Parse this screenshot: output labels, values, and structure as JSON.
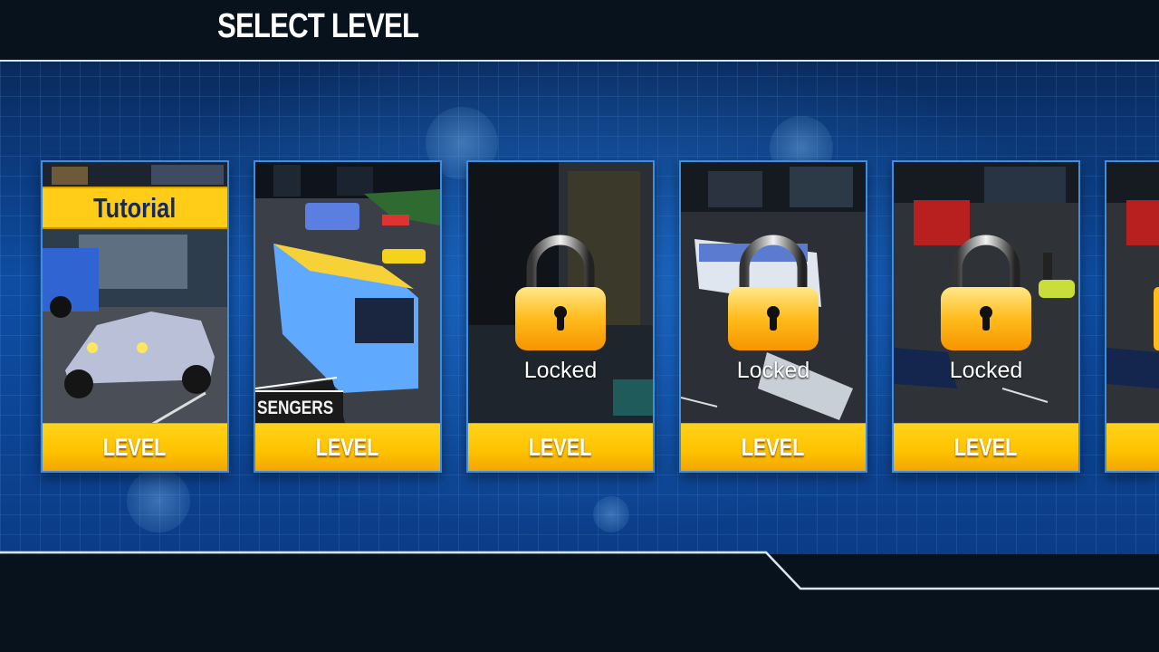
{
  "header": {
    "title": "SELECT LEVEL"
  },
  "levels": [
    {
      "state": "unlocked",
      "ribbon": "Tutorial",
      "button": "LEVEL"
    },
    {
      "state": "unlocked",
      "overlay_text": "SENGERS",
      "button": "LEVEL"
    },
    {
      "state": "locked",
      "locked_text": "Locked",
      "button": "LEVEL"
    },
    {
      "state": "locked",
      "locked_text": "Locked",
      "button": "LEVEL"
    },
    {
      "state": "locked",
      "locked_text": "Locked",
      "button": "LEVEL"
    },
    {
      "state": "locked",
      "button": ""
    }
  ],
  "icons": {
    "lock": "padlock-icon"
  },
  "colors": {
    "accent_yellow": "#ffc400",
    "card_border": "#3d8de0",
    "background_blue": "#0e4da3",
    "dark_bar": "#08121d"
  }
}
